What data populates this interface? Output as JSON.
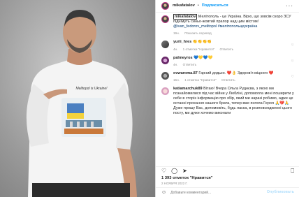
{
  "post": {
    "shirt_text": "Melitopol is Ukraine!",
    "author": "mikafatalov",
    "follow_label": "Подписаться",
    "caption": "Мелітополь - це Україна. Вірю, що зовсім скоро ЗСУ піднімуть синьо-жовтий прапор над цим містом!",
    "caption_link1": "@ivan_fedorov_melitopol",
    "caption_link2": "#мелітопольцеукраїна",
    "caption_time": "19н.",
    "translate_label": "Показать перевод"
  },
  "comments": [
    {
      "user": "yurii_hres",
      "text": "👏👏👏👏",
      "time": "4н.",
      "likes": "1 отметка \"Нравится\"",
      "reply": "Ответить"
    },
    {
      "user": "palmeyros",
      "text": "💙💛💙💛",
      "time": "4н.",
      "likes": "",
      "reply": "Ответить"
    },
    {
      "user": "ovwaroma.87",
      "text": "Гарний дядько. ❤️👌 Здоров'я міцного ❤️",
      "time": "15н.",
      "likes": "1 отметка \"Нравится\"",
      "reply": "Ответить"
    },
    {
      "user": "katiamarchuk89",
      "text": "Вітаю! Вчора Ольга Руднєва, з якою ми познайомилися під час війни у Любліні, допомогла мені поширити у себе в сторіз інформацію про збір, який ми наразі робимо, адже це останні прохання нашого брата, тепер вже янгола Героя 🙏💔🙏 Дуже прошу Вас, допоможіть, будь ласка, в розповсюдженні цього посту, ми дуже хочемо виконати",
      "time": "",
      "likes": "",
      "reply": ""
    }
  ],
  "footer": {
    "likes": "1 393 отметок \"Нравится\"",
    "date": "2 НОЯБРЯ 2022 Г.",
    "comment_placeholder": "Добавьте комментарий...",
    "publish_label": "Опубликовать"
  }
}
